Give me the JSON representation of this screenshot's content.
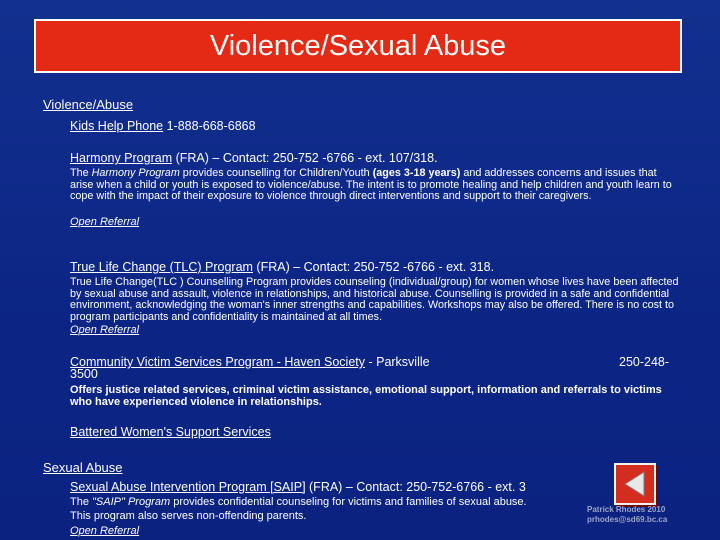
{
  "title": "Violence/Sexual Abuse",
  "violence_section": {
    "heading": "Violence/Abuse",
    "kids_help": {
      "name": "Kids Help Phone",
      "phone": "1-888-668-6868"
    },
    "harmony": {
      "name": "Harmony Program",
      "contact": "(FRA) – Contact: 250-752 -6766 - ext. 107/318.",
      "desc_the": "The ",
      "desc_italic": "Harmony Program",
      "desc_part1": " provides counselling for Children/Youth ",
      "desc_bold": "(ages 3-18 years)",
      "desc_part2": " and addresses concerns and issues that arise when a child or youth is exposed to violence/abuse. The intent is to promote healing and help children and youth learn to cope with the impact of their exposure to violence through direct interventions and support to their caregivers.",
      "referral": "Open Referral"
    },
    "tlc": {
      "name": "True Life Change (TLC) Program",
      "contact": " (FRA) – Contact: 250-752 -6766 - ext. 318.",
      "desc": "True Life Change(TLC ) Counselling Program provides counseling (individual/group) for women whose lives have been affected by sexual abuse and assault, violence in relationships, and historical abuse. Counselling is provided in a safe and confidential environment, acknowledging the woman's inner strengths and capabilities. Workshops may also be offered. There is no cost to program participants and confidentiality is maintained at all times.",
      "referral": "Open Referral"
    },
    "cvs": {
      "name": "Community Victim Services Program - Haven Society",
      "location": " - Parksville",
      "phone_a": "250-248-",
      "phone_b": "3500",
      "desc": "Offers justice related services, criminal victim assistance, emotional support, information and referrals to victims who have experienced violence in relationships."
    },
    "battered": {
      "name": "Battered Women's Support Services"
    }
  },
  "sexual_section": {
    "heading": "Sexual Abuse",
    "saip": {
      "name": "Sexual Abuse Intervention Program [SAIP]",
      "contact": " (FRA) – Contact: 250-752-6766 - ext. 3",
      "desc_the": " The ",
      "desc_italic": "\"SAIP\" Program",
      "desc_part1": " provides confidential counseling for victims and families of sexual abuse.",
      "desc_line2": "This program also serves non-offending parents.",
      "referral": "Open Referral"
    }
  },
  "watermark": {
    "line1": "Patrick Rhodes 2010",
    "line2": "prhodes@sd69.bc.ca"
  },
  "colors": {
    "background": "#0f2a8c",
    "title_bg": "#e42a14",
    "nav_button": "#d42c1e"
  },
  "icons": {
    "nav_button": "back-triangle-icon"
  }
}
